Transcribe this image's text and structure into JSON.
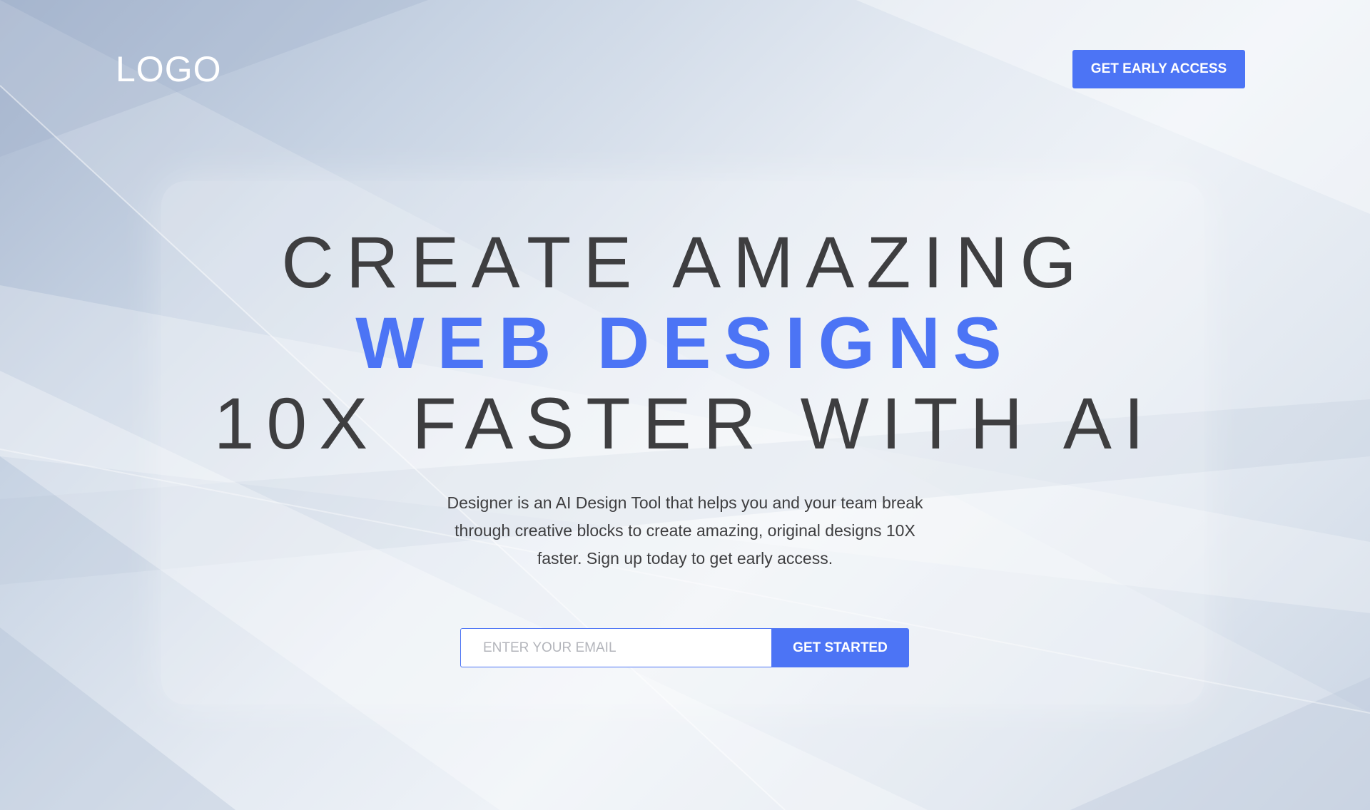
{
  "header": {
    "logo_text": "LOGO",
    "cta_label": "GET EARLY ACCESS"
  },
  "hero": {
    "headline_line1": "CREATE AMAZING",
    "headline_line2": "WEB DESIGNS",
    "headline_line3": "10X FASTER WITH AI",
    "description": "Designer is an AI Design Tool that helps you and your team break through creative blocks to create amazing, original designs 10X faster. Sign up today to get early access."
  },
  "signup": {
    "email_placeholder": "ENTER YOUR EMAIL",
    "email_value": "",
    "submit_label": "GET STARTED"
  },
  "colors": {
    "accent": "#4c74f5",
    "heading_text": "#3e3e40",
    "logo": "#ffffff"
  }
}
